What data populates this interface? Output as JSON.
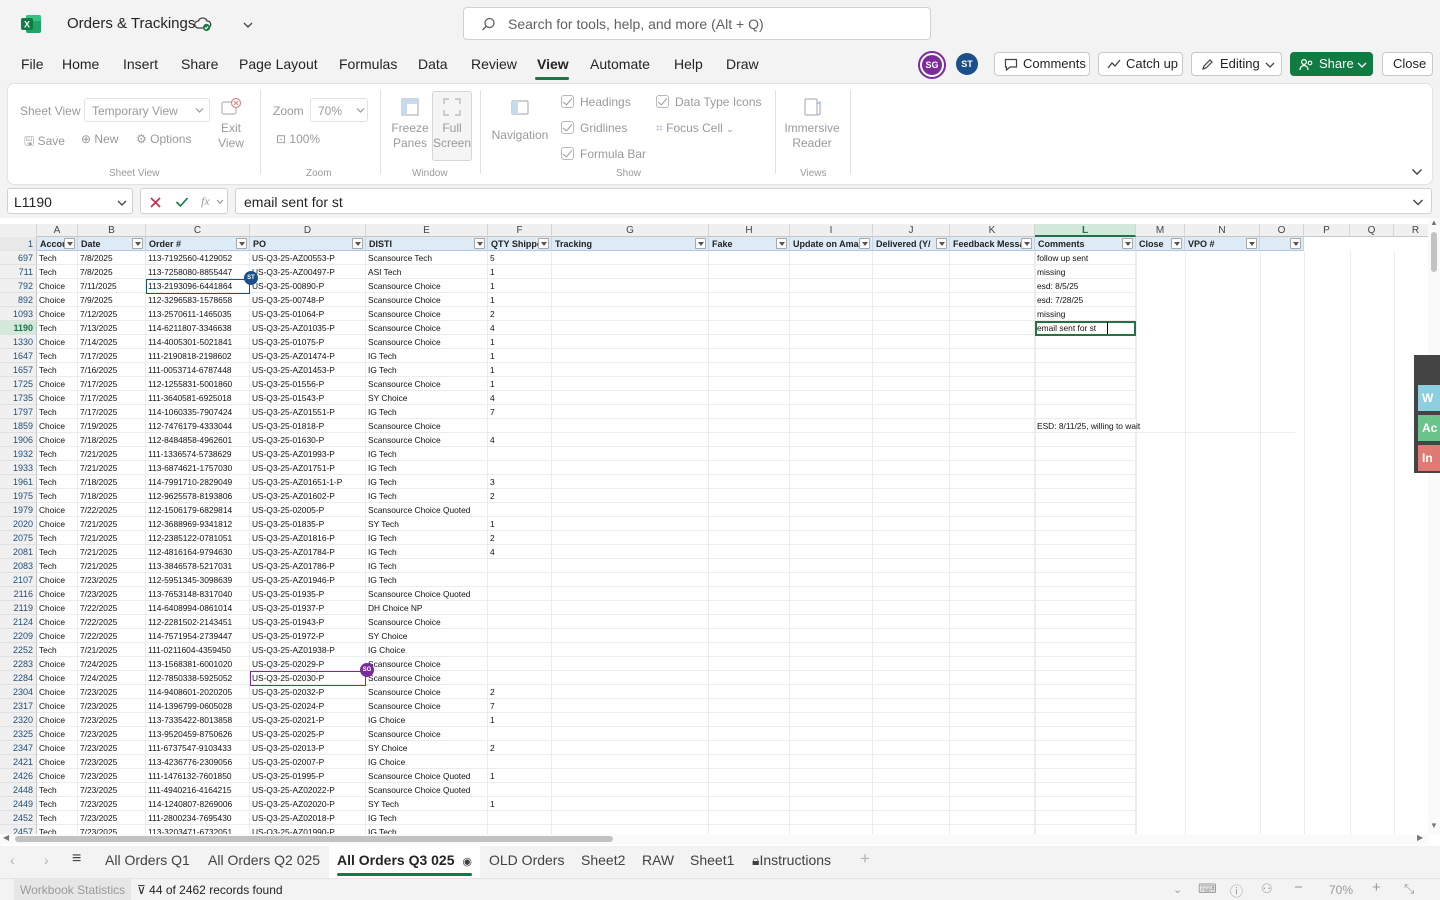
{
  "app": {
    "workbook_title": "Orders & Trackings",
    "search_placeholder": "Search for tools, help, and more (Alt + Q)"
  },
  "menu": [
    "File",
    "Home",
    "Insert",
    "Share",
    "Page Layout",
    "Formulas",
    "Data",
    "Review",
    "View",
    "Automate",
    "Help",
    "Draw"
  ],
  "presence": [
    {
      "initials": "SG",
      "color": "#7b2b9c"
    },
    {
      "initials": "ST",
      "color": "#1b4f8a"
    }
  ],
  "header_buttons": {
    "comments": "Comments",
    "catchup": "Catch up",
    "editing": "Editing",
    "share": "Share",
    "close": "Close"
  },
  "ribbon": {
    "sheet_view_label": "Sheet View",
    "sheet_view_value": "Temporary View",
    "exit_view": "Exit View",
    "save": "Save",
    "new": "New",
    "options": "Options",
    "group_sheet_view": "Sheet View",
    "zoom_label": "Zoom",
    "zoom_value": "70%",
    "zoom_100": "100%",
    "group_zoom": "Zoom",
    "freeze_panes": "Freeze Panes",
    "full_screen": "Full Screen",
    "group_window": "Window",
    "navigation": "Navigation",
    "headings": "Headings",
    "gridlines": "Gridlines",
    "formula_bar": "Formula Bar",
    "data_type_icons": "Data Type Icons",
    "focus_cell": "Focus Cell",
    "group_show": "Show",
    "immersive_reader": "Immersive Reader",
    "group_views": "Views"
  },
  "formula_bar": {
    "name_box": "L1190",
    "content": "email sent for st"
  },
  "columns": [
    "A",
    "B",
    "C",
    "D",
    "E",
    "F",
    "G",
    "H",
    "I",
    "J",
    "K",
    "L",
    "M",
    "N",
    "O",
    "P",
    "Q",
    "R"
  ],
  "table_headers": [
    "Accou",
    "Date",
    "Order #",
    "PO",
    "DISTI",
    "QTY Shippe",
    "Tracking",
    "Fake",
    "Update on Ama",
    "Delivered (Y/",
    "Feedback Messa",
    "Comments",
    "Close",
    "VPO #",
    ""
  ],
  "rows": [
    {
      "num": "697",
      "a": "Tech",
      "b": "7/8/2025",
      "c": "113-7192560-4129052",
      "d": "US-Q3-25-AZ00553-P",
      "e": "Scansource Tech",
      "f": "5",
      "l": "follow up sent"
    },
    {
      "num": "711",
      "a": "Tech",
      "b": "7/8/2025",
      "c": "113-7258080-8855447",
      "d": "US-Q3-25-AZ00497-P",
      "e": "ASI Tech",
      "f": "1",
      "l": "missing"
    },
    {
      "num": "792",
      "a": "Choice",
      "b": "7/11/2025",
      "c": "113-2193096-6441864",
      "d": "US-Q3-25-00890-P",
      "e": "Scansource Choice",
      "f": "1",
      "l": "esd: 8/5/25"
    },
    {
      "num": "892",
      "a": "Choice",
      "b": "7/9/2025",
      "c": "112-3296583-1578658",
      "d": "US-Q3-25-00748-P",
      "e": "Scansource Choice",
      "f": "1",
      "l": "esd: 7/28/25"
    },
    {
      "num": "1093",
      "a": "Choice",
      "b": "7/12/2025",
      "c": "113-2570611-1465035",
      "d": "US-Q3-25-01064-P",
      "e": "Scansource Choice",
      "f": "2",
      "l": "missing"
    },
    {
      "num": "1190",
      "a": "Tech",
      "b": "7/13/2025",
      "c": "114-6211807-3346638",
      "d": "US-Q3-25-AZ01035-P",
      "e": "Scansource Choice",
      "f": "4",
      "l": "email sent for st"
    },
    {
      "num": "1330",
      "a": "Choice",
      "b": "7/14/2025",
      "c": "114-4005301-5021841",
      "d": "US-Q3-25-01075-P",
      "e": "Scansource Choice",
      "f": "1",
      "l": ""
    },
    {
      "num": "1647",
      "a": "Tech",
      "b": "7/17/2025",
      "c": "111-2190818-2198602",
      "d": "US-Q3-25-AZ01474-P",
      "e": "IG Tech",
      "f": "1",
      "l": ""
    },
    {
      "num": "1657",
      "a": "Tech",
      "b": "7/16/2025",
      "c": "111-0053714-6787448",
      "d": "US-Q3-25-AZ01453-P",
      "e": "IG Tech",
      "f": "1",
      "l": ""
    },
    {
      "num": "1725",
      "a": "Choice",
      "b": "7/17/2025",
      "c": "112-1255831-5001860",
      "d": "US-Q3-25-01556-P",
      "e": "Scansource Choice",
      "f": "1",
      "l": ""
    },
    {
      "num": "1735",
      "a": "Choice",
      "b": "7/17/2025",
      "c": "111-3640581-6925018",
      "d": "US-Q3-25-01543-P",
      "e": "SY Choice",
      "f": "4",
      "l": ""
    },
    {
      "num": "1797",
      "a": "Tech",
      "b": "7/17/2025",
      "c": "114-1060335-7907424",
      "d": "US-Q3-25-AZ01551-P",
      "e": "IG Tech",
      "f": "7",
      "l": ""
    },
    {
      "num": "1859",
      "a": "Choice",
      "b": "7/19/2025",
      "c": "112-7476179-4333044",
      "d": "US-Q3-25-01818-P",
      "e": "Scansource Choice",
      "f": "",
      "l": "ESD: 8/11/25, willing to wait"
    },
    {
      "num": "1906",
      "a": "Choice",
      "b": "7/18/2025",
      "c": "112-8484858-4962601",
      "d": "US-Q3-25-01630-P",
      "e": "Scansource Choice",
      "f": "4",
      "l": ""
    },
    {
      "num": "1932",
      "a": "Tech",
      "b": "7/21/2025",
      "c": "111-1336574-5738629",
      "d": "US-Q3-25-AZ01993-P",
      "e": "IG Tech",
      "f": "",
      "l": ""
    },
    {
      "num": "1933",
      "a": "Tech",
      "b": "7/21/2025",
      "c": "113-6874621-1757030",
      "d": "US-Q3-25-AZ01751-P",
      "e": "IG Tech",
      "f": "",
      "l": ""
    },
    {
      "num": "1961",
      "a": "Tech",
      "b": "7/18/2025",
      "c": "114-7991710-2829049",
      "d": "US-Q3-25-AZ01651-1-P",
      "e": "IG Tech",
      "f": "3",
      "l": ""
    },
    {
      "num": "1975",
      "a": "Tech",
      "b": "7/18/2025",
      "c": "112-9625578-8193806",
      "d": "US-Q3-25-AZ01602-P",
      "e": "IG Tech",
      "f": "2",
      "l": ""
    },
    {
      "num": "1979",
      "a": "Choice",
      "b": "7/22/2025",
      "c": "112-1506179-6829814",
      "d": "US-Q3-25-02005-P",
      "e": "Scansource Choice Quoted",
      "f": "",
      "l": ""
    },
    {
      "num": "2020",
      "a": "Choice",
      "b": "7/21/2025",
      "c": "112-3688969-9341812",
      "d": "US-Q3-25-01835-P",
      "e": "SY Tech",
      "f": "1",
      "l": ""
    },
    {
      "num": "2075",
      "a": "Tech",
      "b": "7/21/2025",
      "c": "112-2385122-0781051",
      "d": "US-Q3-25-AZ01816-P",
      "e": "IG Tech",
      "f": "2",
      "l": ""
    },
    {
      "num": "2081",
      "a": "Tech",
      "b": "7/21/2025",
      "c": "112-4816164-9794630",
      "d": "US-Q3-25-AZ01784-P",
      "e": "IG Tech",
      "f": "4",
      "l": ""
    },
    {
      "num": "2083",
      "a": "Tech",
      "b": "7/21/2025",
      "c": "113-3846578-5217031",
      "d": "US-Q3-25-AZ01786-P",
      "e": "IG Tech",
      "f": "",
      "l": ""
    },
    {
      "num": "2107",
      "a": "Choice",
      "b": "7/23/2025",
      "c": "112-5951345-3098639",
      "d": "US-Q3-25-AZ01946-P",
      "e": "IG Tech",
      "f": "",
      "l": ""
    },
    {
      "num": "2116",
      "a": "Choice",
      "b": "7/23/2025",
      "c": "113-7653148-8317040",
      "d": "US-Q3-25-01935-P",
      "e": "Scansource Choice Quoted",
      "f": "",
      "l": ""
    },
    {
      "num": "2119",
      "a": "Choice",
      "b": "7/22/2025",
      "c": "114-6408994-0861014",
      "d": "US-Q3-25-01937-P",
      "e": "DH Choice NP",
      "f": "",
      "l": ""
    },
    {
      "num": "2124",
      "a": "Choice",
      "b": "7/22/2025",
      "c": "112-2281502-2143451",
      "d": "US-Q3-25-01943-P",
      "e": "Scansource Choice",
      "f": "",
      "l": ""
    },
    {
      "num": "2209",
      "a": "Choice",
      "b": "7/22/2025",
      "c": "114-7571954-2739447",
      "d": "US-Q3-25-01972-P",
      "e": "SY Choice",
      "f": "",
      "l": ""
    },
    {
      "num": "2252",
      "a": "Tech",
      "b": "7/21/2025",
      "c": "111-0211604-4359450",
      "d": "US-Q3-25-AZ01938-P",
      "e": "IG Choice",
      "f": "",
      "l": ""
    },
    {
      "num": "2283",
      "a": "Choice",
      "b": "7/24/2025",
      "c": "113-1568381-6001020",
      "d": "US-Q3-25-02029-P",
      "e": "Scansource Choice",
      "f": "",
      "l": ""
    },
    {
      "num": "2284",
      "a": "Choice",
      "b": "7/24/2025",
      "c": "112-7850338-5925052",
      "d": "US-Q3-25-02030-P",
      "e": "Scansource Choice",
      "f": "",
      "l": ""
    },
    {
      "num": "2304",
      "a": "Choice",
      "b": "7/23/2025",
      "c": "114-9408601-2020205",
      "d": "US-Q3-25-02032-P",
      "e": "Scansource Choice",
      "f": "2",
      "l": ""
    },
    {
      "num": "2317",
      "a": "Choice",
      "b": "7/23/2025",
      "c": "114-1396799-0605028",
      "d": "US-Q3-25-02024-P",
      "e": "Scansource Choice",
      "f": "7",
      "l": ""
    },
    {
      "num": "2320",
      "a": "Choice",
      "b": "7/23/2025",
      "c": "113-7335422-8013858",
      "d": "US-Q3-25-02021-P",
      "e": "IG Choice",
      "f": "1",
      "l": ""
    },
    {
      "num": "2325",
      "a": "Choice",
      "b": "7/23/2025",
      "c": "113-9520459-8750626",
      "d": "US-Q3-25-02025-P",
      "e": "Scansource Choice",
      "f": "",
      "l": ""
    },
    {
      "num": "2347",
      "a": "Choice",
      "b": "7/23/2025",
      "c": "111-6737547-9103433",
      "d": "US-Q3-25-02013-P",
      "e": "SY Choice",
      "f": "2",
      "l": ""
    },
    {
      "num": "2421",
      "a": "Choice",
      "b": "7/23/2025",
      "c": "113-4236776-2309056",
      "d": "US-Q3-25-02007-P",
      "e": "IG Choice",
      "f": "",
      "l": ""
    },
    {
      "num": "2426",
      "a": "Choice",
      "b": "7/23/2025",
      "c": "111-1476132-7601850",
      "d": "US-Q3-25-01995-P",
      "e": "Scansource Choice Quoted",
      "f": "1",
      "l": ""
    },
    {
      "num": "2448",
      "a": "Tech",
      "b": "7/23/2025",
      "c": "111-4940216-4164215",
      "d": "US-Q3-25-AZ02022-P",
      "e": "Scansource Choice Quoted",
      "f": "",
      "l": ""
    },
    {
      "num": "2449",
      "a": "Tech",
      "b": "7/23/2025",
      "c": "114-1240807-8269006",
      "d": "US-Q3-25-AZ02020-P",
      "e": "SY Tech",
      "f": "1",
      "l": ""
    },
    {
      "num": "2452",
      "a": "Tech",
      "b": "7/23/2025",
      "c": "111-2800234-7695430",
      "d": "US-Q3-25-AZ02018-P",
      "e": "IG Tech",
      "f": "",
      "l": ""
    },
    {
      "num": "2457",
      "a": "Tech",
      "b": "7/23/2025",
      "c": "113-3203471-6732051",
      "d": "US-Q3-25-AZ01990-P",
      "e": "IG Tech",
      "f": "",
      "l": ""
    }
  ],
  "cursor_badges": {
    "c": "ST",
    "d": "SG"
  },
  "side_panel_letters": [
    "W",
    "Ac",
    "In"
  ],
  "sheet_tabs": [
    "All Orders Q1",
    "All Orders Q2 025",
    "All Orders Q3 025",
    "OLD Orders",
    "Sheet2",
    "RAW",
    "Sheet1",
    "Instructions"
  ],
  "active_tab": "All Orders Q3 025",
  "status": {
    "workbook_stats": "Workbook Statistics",
    "records": "44 of 2462 records found",
    "zoom": "70%"
  }
}
